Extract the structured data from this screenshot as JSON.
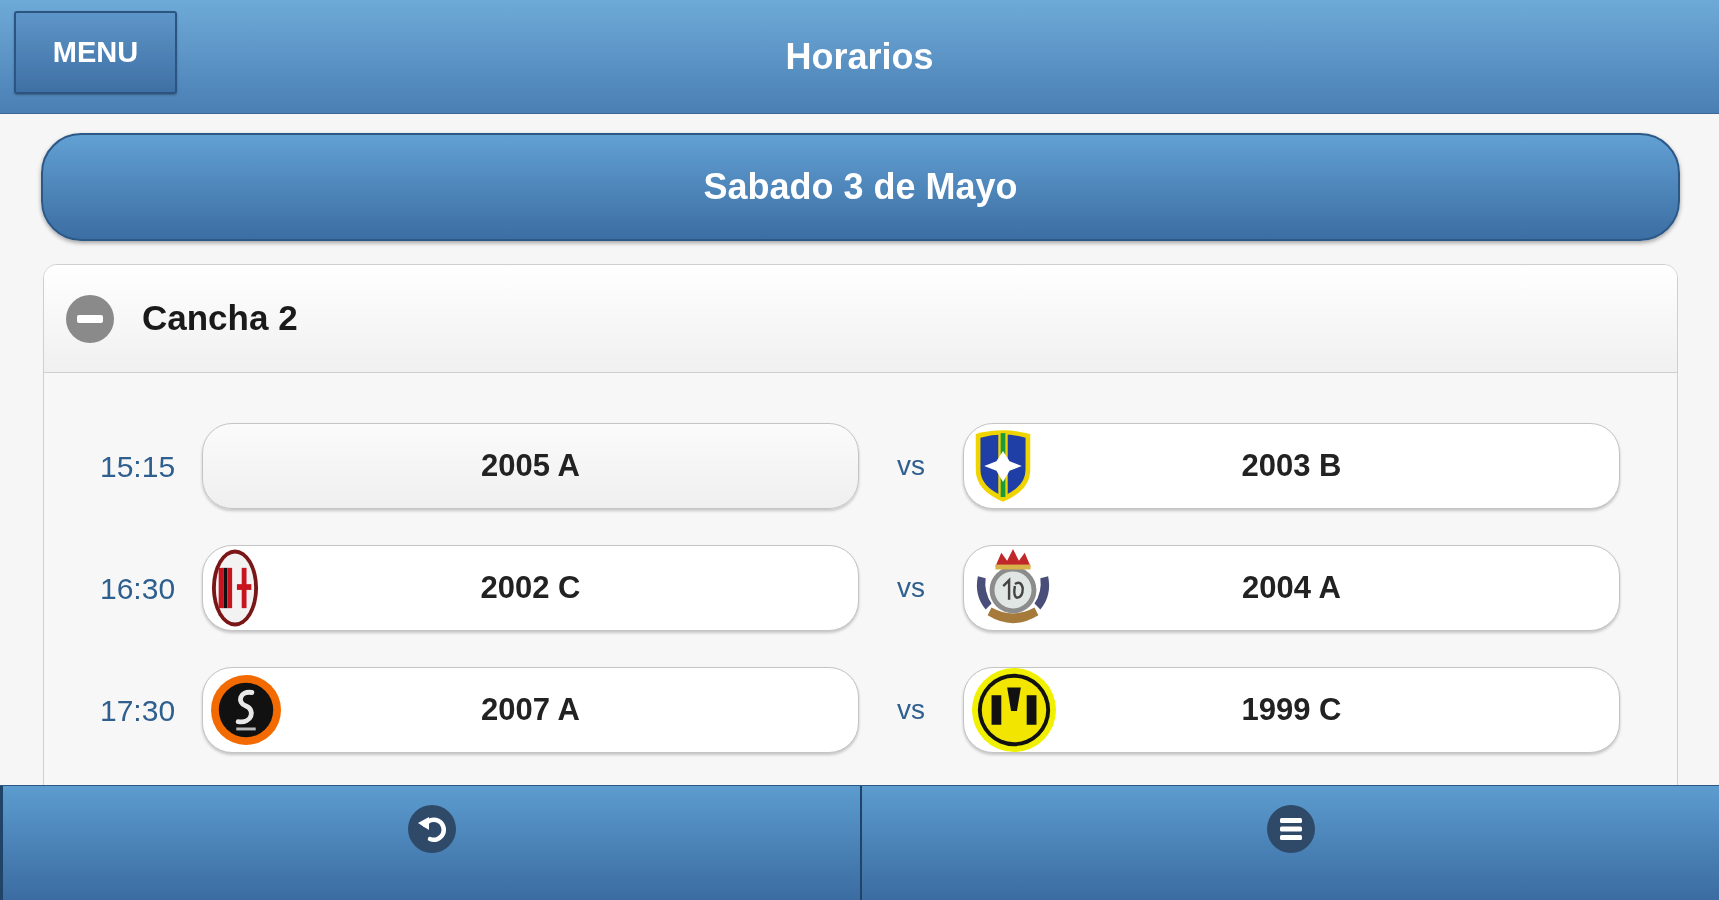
{
  "header": {
    "menu_button": "MENU",
    "title": "Horarios"
  },
  "date_button": "Sabado 3 de Mayo",
  "court": {
    "title": "Cancha 2",
    "expanded": true,
    "matches": [
      {
        "time": "15:15",
        "home": {
          "name": "2005 A",
          "kind": "plain"
        },
        "separator": "vs",
        "away": {
          "name": "2003 B",
          "kind": "shield"
        }
      },
      {
        "time": "16:30",
        "home": {
          "name": "2002 C",
          "kind": "oval"
        },
        "separator": "vs",
        "away": {
          "name": "2004 A",
          "kind": "crown"
        }
      },
      {
        "time": "17:30",
        "home": {
          "name": "2007 A",
          "kind": "ring"
        },
        "separator": "vs",
        "away": {
          "name": "1999 C",
          "kind": "disc"
        }
      }
    ]
  }
}
